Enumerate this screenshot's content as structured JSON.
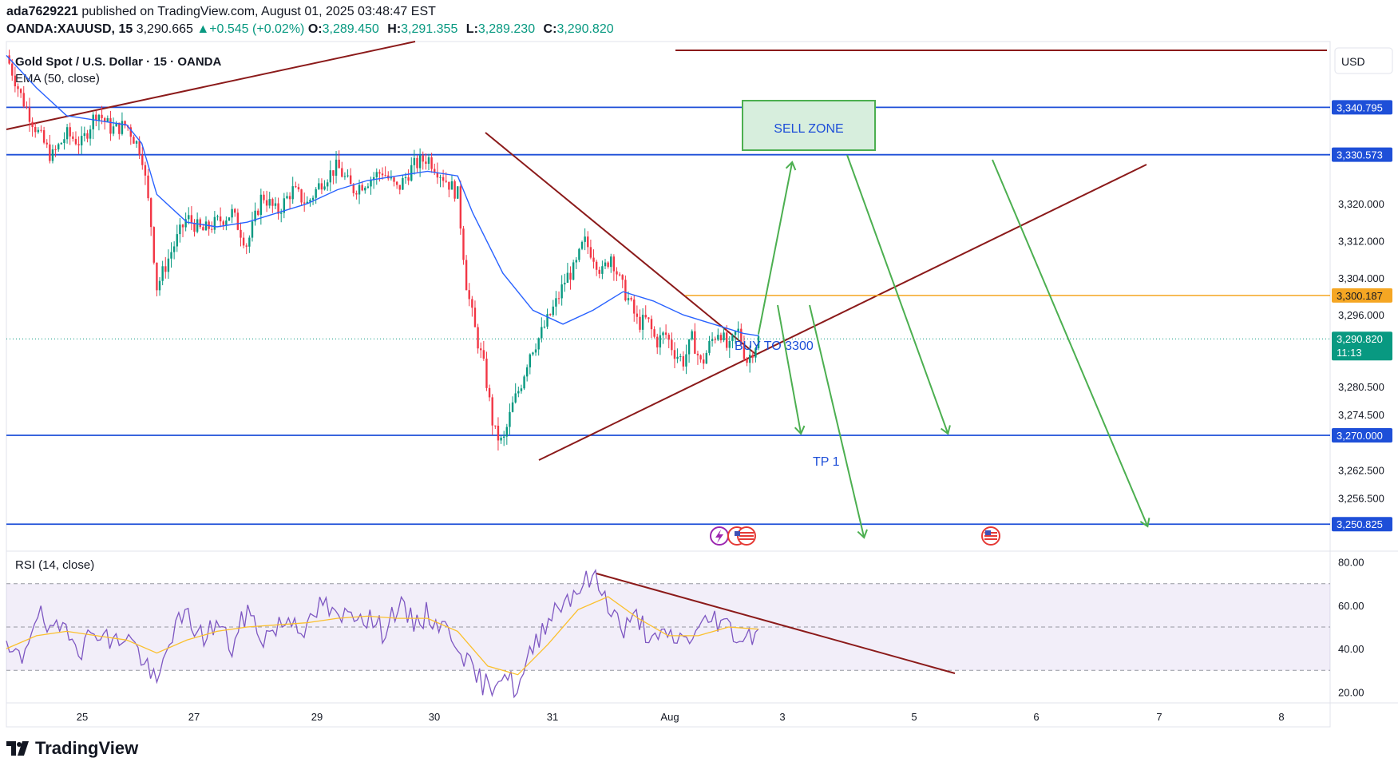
{
  "header": {
    "user": "ada7629221",
    "published_text": "published on TradingView.com, August 01, 2025 03:48:47 EST",
    "symbol": "OANDA:XAUUSD, 15",
    "price": "3,290.665",
    "change": "+0.545 (+0.02%)",
    "ohlc": [
      {
        "k": "O:",
        "v": "3,289.450"
      },
      {
        "k": "H:",
        "v": "3,291.355"
      },
      {
        "k": "L:",
        "v": "3,289.230"
      },
      {
        "k": "C:",
        "v": "3,290.820"
      }
    ]
  },
  "legend": {
    "title": "Gold Spot / U.S. Dollar · 15 · OANDA",
    "ema": "EMA (50, close)",
    "rsi": "RSI (14, close)"
  },
  "currency": "USD",
  "footer": {
    "brand": "TradingView"
  },
  "colors": {
    "up": "#089981",
    "down": "#f23645",
    "ema": "#2962ff",
    "rsi": "#7e57c2",
    "rsi_ma": "#fbc02d",
    "trend": "#8b1a1a",
    "hline": "#1e4fd8",
    "orange": "#f5a623",
    "arrow": "#4caf50",
    "zone_fill": "#d7eedd",
    "zone_border": "#4caf50"
  },
  "chart_data": [
    {
      "type": "candlestick",
      "title": "Gold Spot / U.S. Dollar · 15 · OANDA",
      "ylim": [
        3245,
        3355
      ],
      "x_tick_labels": [
        "25",
        "27",
        "29",
        "30",
        "31",
        "Aug",
        "3",
        "5",
        "6",
        "7",
        "8"
      ],
      "y_tick_labels": [
        "3,320.000",
        "3,312.000",
        "3,304.000",
        "3,296.000",
        "3,280.500",
        "3,274.500",
        "3,262.500",
        "3,256.500"
      ],
      "y_tick_values": [
        3320,
        3312,
        3304,
        3296,
        3280.5,
        3274.5,
        3262.5,
        3256.5
      ],
      "horizontal_levels": [
        {
          "label": "3,340.795",
          "value": 3340.795
        },
        {
          "label": "3,330.573",
          "value": 3330.573
        },
        {
          "label": "3,270.000",
          "value": 3270.0
        },
        {
          "label": "3,250.825",
          "value": 3250.825
        }
      ],
      "orange_level": {
        "label": "3,300.187",
        "value": 3300.187
      },
      "last_price": {
        "label": "3,290.820",
        "value": 3290.82,
        "countdown": "11:13"
      },
      "annotations": {
        "sell_zone": "SELL ZONE",
        "buy": "BUY TO 3300",
        "tp": "TP 1"
      },
      "price_path": [
        [
          0,
          3352
        ],
        [
          0.5,
          3343
        ],
        [
          1.0,
          3336
        ],
        [
          1.5,
          3330
        ],
        [
          2.0,
          3335
        ],
        [
          2.5,
          3333
        ],
        [
          3.0,
          3340
        ],
        [
          3.5,
          3336
        ],
        [
          4.0,
          3337
        ],
        [
          4.5,
          3331
        ],
        [
          4.8,
          3316
        ],
        [
          5.0,
          3302
        ],
        [
          5.5,
          3310
        ],
        [
          6.0,
          3317
        ],
        [
          6.5,
          3314
        ],
        [
          7.0,
          3316
        ],
        [
          7.5,
          3318
        ],
        [
          8.0,
          3311
        ],
        [
          8.5,
          3322
        ],
        [
          9.0,
          3318
        ],
        [
          9.5,
          3323
        ],
        [
          10.0,
          3320
        ],
        [
          10.5,
          3325
        ],
        [
          11.0,
          3328
        ],
        [
          11.5,
          3323
        ],
        [
          12.0,
          3325
        ],
        [
          12.5,
          3327
        ],
        [
          13.0,
          3323
        ],
        [
          13.5,
          3328
        ],
        [
          14.0,
          3330
        ],
        [
          14.5,
          3326
        ],
        [
          15.0,
          3322
        ],
        [
          15.3,
          3302
        ],
        [
          15.6,
          3292
        ],
        [
          15.9,
          3284
        ],
        [
          16.2,
          3271
        ],
        [
          16.5,
          3268
        ],
        [
          16.8,
          3276
        ],
        [
          17.1,
          3281
        ],
        [
          17.4,
          3288
        ],
        [
          17.7,
          3291
        ],
        [
          18.0,
          3295
        ],
        [
          18.3,
          3299
        ],
        [
          18.6,
          3304
        ],
        [
          18.9,
          3306
        ],
        [
          19.2,
          3312
        ],
        [
          19.5,
          3309
        ],
        [
          19.8,
          3305
        ],
        [
          20.1,
          3309
        ],
        [
          20.4,
          3303
        ],
        [
          20.7,
          3299
        ],
        [
          21.0,
          3294
        ],
        [
          21.3,
          3295
        ],
        [
          21.6,
          3290
        ],
        [
          21.9,
          3292
        ],
        [
          22.2,
          3288
        ],
        [
          22.5,
          3286
        ],
        [
          22.8,
          3291
        ],
        [
          23.1,
          3285
        ],
        [
          23.4,
          3290
        ],
        [
          23.7,
          3293
        ],
        [
          24.0,
          3288
        ],
        [
          24.3,
          3293
        ],
        [
          24.6,
          3286
        ],
        [
          25.0,
          3290.82
        ]
      ],
      "ema_path": [
        [
          0,
          3352
        ],
        [
          1.0,
          3345
        ],
        [
          2.0,
          3339
        ],
        [
          3.0,
          3338
        ],
        [
          4.0,
          3337
        ],
        [
          4.5,
          3333
        ],
        [
          5.0,
          3322
        ],
        [
          6.0,
          3316
        ],
        [
          7.0,
          3315
        ],
        [
          8.0,
          3316
        ],
        [
          9.0,
          3318
        ],
        [
          10.0,
          3320
        ],
        [
          11.0,
          3323
        ],
        [
          12.0,
          3325
        ],
        [
          13.0,
          3326
        ],
        [
          14.0,
          3327
        ],
        [
          15.0,
          3326
        ],
        [
          15.5,
          3318
        ],
        [
          16.5,
          3305
        ],
        [
          17.5,
          3297
        ],
        [
          18.5,
          3294
        ],
        [
          19.5,
          3297
        ],
        [
          20.5,
          3301
        ],
        [
          21.5,
          3299
        ],
        [
          22.5,
          3296
        ],
        [
          23.5,
          3294
        ],
        [
          24.5,
          3292
        ],
        [
          25.0,
          3291.5
        ]
      ],
      "x_domain": [
        0,
        44
      ]
    },
    {
      "type": "line",
      "title": "RSI (14, close)",
      "ylim": [
        15,
        85
      ],
      "y_tick_labels": [
        "80.00",
        "60.00",
        "40.00",
        "20.00"
      ],
      "y_tick_values": [
        80,
        60,
        40,
        20
      ],
      "bands": [
        70,
        50,
        30
      ],
      "rsi_path": [
        [
          0,
          38
        ],
        [
          0.5,
          35
        ],
        [
          1.0,
          58
        ],
        [
          1.5,
          45
        ],
        [
          2.0,
          52
        ],
        [
          2.5,
          40
        ],
        [
          3.0,
          50
        ],
        [
          3.5,
          42
        ],
        [
          4.0,
          47
        ],
        [
          4.5,
          36
        ],
        [
          5.0,
          22
        ],
        [
          5.5,
          48
        ],
        [
          6.0,
          55
        ],
        [
          6.5,
          45
        ],
        [
          7.0,
          52
        ],
        [
          7.5,
          40
        ],
        [
          8.0,
          58
        ],
        [
          8.5,
          45
        ],
        [
          9.0,
          50
        ],
        [
          9.5,
          55
        ],
        [
          10.0,
          48
        ],
        [
          10.5,
          62
        ],
        [
          11.0,
          52
        ],
        [
          11.5,
          58
        ],
        [
          12.0,
          55
        ],
        [
          12.5,
          48
        ],
        [
          13.0,
          60
        ],
        [
          13.5,
          52
        ],
        [
          14.0,
          56
        ],
        [
          14.5,
          50
        ],
        [
          15.0,
          44
        ],
        [
          15.5,
          28
        ],
        [
          16.0,
          22
        ],
        [
          16.5,
          30
        ],
        [
          17.0,
          20
        ],
        [
          17.5,
          40
        ],
        [
          18.0,
          55
        ],
        [
          18.5,
          62
        ],
        [
          19.0,
          68
        ],
        [
          19.5,
          73
        ],
        [
          20.0,
          62
        ],
        [
          20.5,
          48
        ],
        [
          21.0,
          55
        ],
        [
          21.5,
          42
        ],
        [
          22.0,
          46
        ],
        [
          22.5,
          44
        ],
        [
          23.0,
          48
        ],
        [
          23.5,
          55
        ],
        [
          24.0,
          50
        ],
        [
          24.5,
          44
        ],
        [
          25.0,
          50
        ]
      ],
      "rsi_ma_path": [
        [
          0,
          40
        ],
        [
          1.0,
          46
        ],
        [
          2.0,
          48
        ],
        [
          3.0,
          46
        ],
        [
          4.0,
          44
        ],
        [
          5.0,
          38
        ],
        [
          6.0,
          44
        ],
        [
          7.0,
          48
        ],
        [
          8.0,
          50
        ],
        [
          9.0,
          51
        ],
        [
          10.0,
          52
        ],
        [
          11.0,
          54
        ],
        [
          12.0,
          55
        ],
        [
          13.0,
          54
        ],
        [
          14.0,
          54
        ],
        [
          15.0,
          48
        ],
        [
          16.0,
          32
        ],
        [
          17.0,
          28
        ],
        [
          18.0,
          42
        ],
        [
          19.0,
          58
        ],
        [
          20.0,
          64
        ],
        [
          21.0,
          54
        ],
        [
          22.0,
          46
        ],
        [
          23.0,
          46
        ],
        [
          24.0,
          50
        ],
        [
          25.0,
          49
        ]
      ],
      "x_domain": [
        0,
        44
      ]
    }
  ]
}
